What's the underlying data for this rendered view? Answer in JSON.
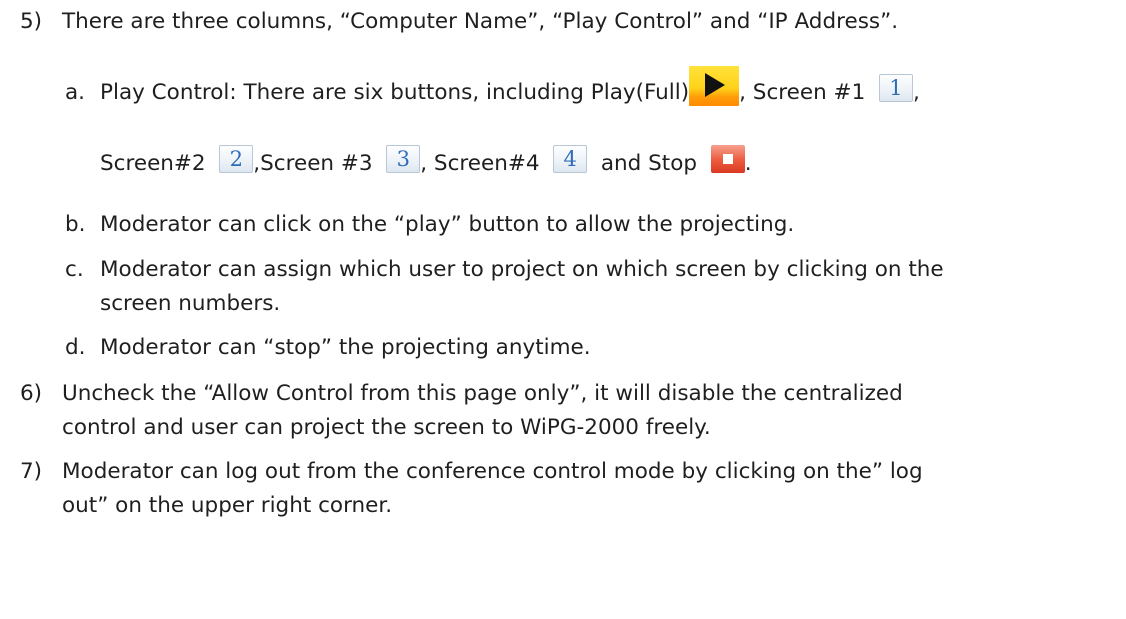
{
  "item5": {
    "num": "5)",
    "text": "There are three columns, “Computer Name”, “Play Control” and “IP Address”."
  },
  "item5a": {
    "num": "a.",
    "text1": "Play Control: There are six buttons, including Play(Full)",
    "text2": ", Screen #1",
    "text3": ",",
    "text4": "Screen#2",
    "text5": ",Screen #3",
    "text6": ", Screen#4",
    "text7": "and Stop",
    "text8": "."
  },
  "icons": {
    "play": "play-full-icon",
    "screen1": "1",
    "screen2": "2",
    "screen3": "3",
    "screen4": "4",
    "stop": "stop-icon"
  },
  "item5b": {
    "num": "b.",
    "text": "Moderator can click on the “play” button to allow the projecting."
  },
  "item5c": {
    "num": "c.",
    "line1": "Moderator can assign which user to project on which screen by clicking on the",
    "line2": "screen numbers."
  },
  "item5d": {
    "num": "d.",
    "text": "Moderator can “stop” the projecting anytime."
  },
  "item6": {
    "num": "6)",
    "line1": "Uncheck the “Allow Control from this page only”, it will disable the centralized",
    "line2": "control and user can project the screen to WiPG-2000 freely."
  },
  "item7": {
    "num": "7)",
    "line1": "Moderator can log out from the conference control mode by clicking on the” log",
    "line2": "out” on the upper right corner."
  },
  "colors": {
    "text": "#1f1f1f",
    "number_icon_text": "#2e6eb7",
    "play_icon": "#ffd21a",
    "stop_icon": "#e04a30"
  }
}
